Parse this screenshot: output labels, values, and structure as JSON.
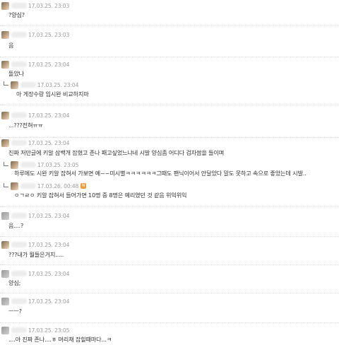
{
  "comments": [
    {
      "time": "17.03.25. 23:03",
      "text": "?양심?",
      "reply": false
    },
    {
      "time": "17.03.25. 23:03",
      "text": "음",
      "reply": false
    },
    {
      "time": "17.03.25. 23:04",
      "text": "돌았나",
      "reply": false
    },
    {
      "time": "17.03.25. 23:04",
      "text": "아 게장수랑 임시완 비교하지마",
      "reply": true
    },
    {
      "time": "17.03.25. 23:04",
      "text": "...???전혀ㅠㅠ",
      "reply": false
    },
    {
      "time": "17.03.25. 23:04",
      "text": "진짜 저만글에 키알 삼백개 잡혔고 존나 패고싶었느냐네 시발 양심좀 어디다 검자쌈을 들이며",
      "reply": false
    },
    {
      "time": "17.03.25. 23:05",
      "text": "하루에도 시완 키알 잡혀서 가보면 예~~미시별ㅋㅋㅋㅋㅋㅋ그때도 팬닉이어서 안달았다 말도 못하고 속으로 좋았는데 시발..",
      "reply": true
    },
    {
      "time": "17.03.26. 00:48",
      "text": "ㅇㄱㄹㅇ 키알 잡혀서 들어가면 10명 중 8명은 예리였던 것 같음 위익위익",
      "reply": true,
      "badge": "N"
    },
    {
      "time": "17.03.25. 23:04",
      "text": "음....?",
      "reply": false
    },
    {
      "time": "17.03.25. 23:04",
      "text": "???내가 뭘들은거지.....",
      "reply": false
    },
    {
      "time": "17.03.25. 23:04",
      "text": "양심;",
      "reply": false
    },
    {
      "time": "17.03.25. 23:04",
      "text": "ㅡㅡ?",
      "reply": false
    },
    {
      "time": "17.03.25. 23:05",
      "text": "....아 진짜 존나....ㅎ 머리채 잡힐때마다...ㅋ",
      "reply": false
    }
  ]
}
